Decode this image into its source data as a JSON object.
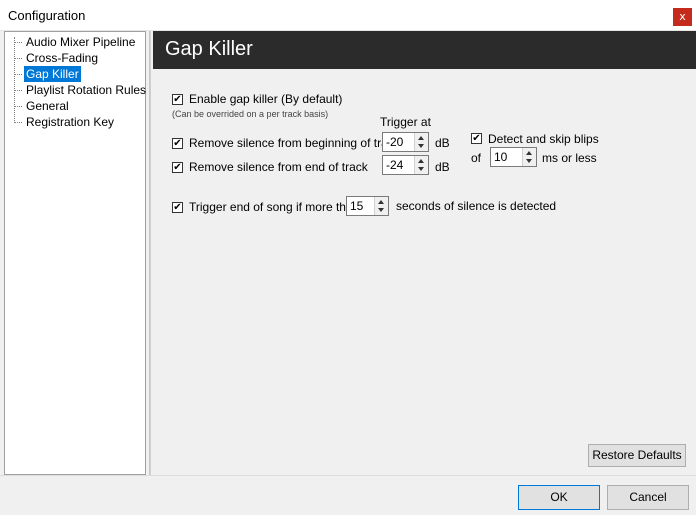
{
  "window": {
    "title": "Configuration",
    "close_glyph": "x"
  },
  "tree": {
    "items": [
      {
        "label": "Audio Mixer Pipeline",
        "selected": false
      },
      {
        "label": "Cross-Fading",
        "selected": false
      },
      {
        "label": "Gap Killer",
        "selected": true
      },
      {
        "label": "Playlist Rotation Rules",
        "selected": false
      },
      {
        "label": "General",
        "selected": false
      },
      {
        "label": "Registration Key",
        "selected": false
      }
    ]
  },
  "panel": {
    "header": "Gap Killer",
    "enable_gap_killer": {
      "label": "Enable gap killer (By default)",
      "checked": true
    },
    "override_note": "(Can be overrided on a per track basis)",
    "trigger_at_label": "Trigger at",
    "remove_begin": {
      "label": "Remove silence from beginning of track",
      "checked": true,
      "value": "-20",
      "unit": "dB"
    },
    "remove_end": {
      "label": "Remove silence from end of track",
      "checked": true,
      "value": "-24",
      "unit": "dB"
    },
    "detect_blips": {
      "label": "Detect and skip blips",
      "checked": true,
      "of_label": "of",
      "value": "10",
      "unit": "ms or less"
    },
    "trigger_end": {
      "label": "Trigger end of song if more than",
      "checked": true,
      "value": "15",
      "suffix": "seconds of silence is detected"
    },
    "restore_defaults": "Restore Defaults"
  },
  "footer": {
    "ok": "OK",
    "cancel": "Cancel"
  },
  "colors": {
    "header_bg": "#2b2b2b",
    "selection": "#0078d7",
    "close_red": "#c42b1c"
  }
}
